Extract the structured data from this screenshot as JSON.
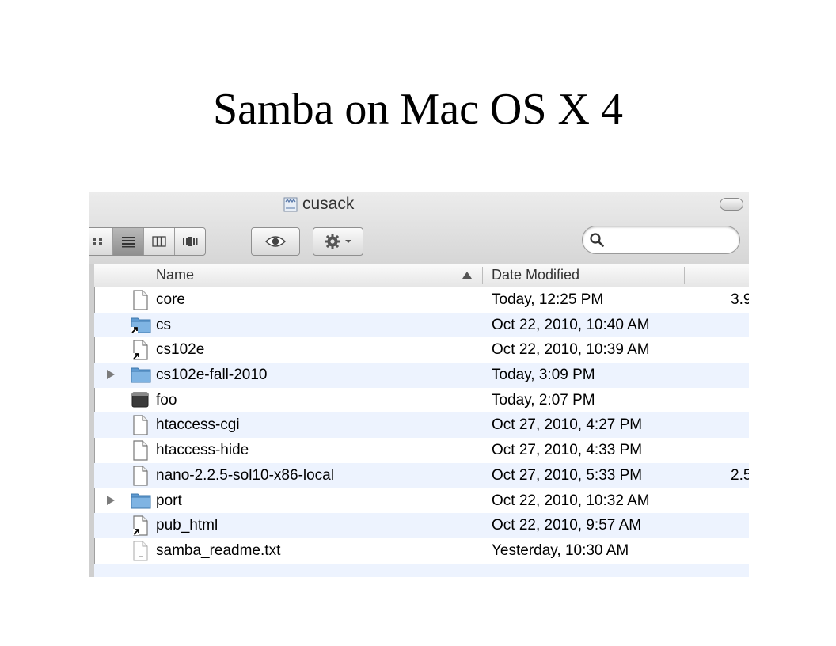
{
  "slide": {
    "title": "Samba on Mac OS X 4"
  },
  "window": {
    "title": "cusack"
  },
  "search": {
    "placeholder": ""
  },
  "columns": {
    "name": "Name",
    "date_modified": "Date Modified"
  },
  "files": [
    {
      "name": "core",
      "date": "Today, 12:25 PM",
      "size": "3.9",
      "icon": "document-icon",
      "expandable": false
    },
    {
      "name": "cs",
      "date": "Oct 22, 2010, 10:40 AM",
      "size": "",
      "icon": "folder-alias-icon",
      "expandable": false
    },
    {
      "name": "cs102e",
      "date": "Oct 22, 2010, 10:39 AM",
      "size": "",
      "icon": "document-alias-icon",
      "expandable": false
    },
    {
      "name": "cs102e-fall-2010",
      "date": "Today, 3:09 PM",
      "size": "",
      "icon": "folder-icon",
      "expandable": true
    },
    {
      "name": "foo",
      "date": "Today, 2:07 PM",
      "size": "",
      "icon": "executable-icon",
      "expandable": false
    },
    {
      "name": "htaccess-cgi",
      "date": "Oct 27, 2010, 4:27 PM",
      "size": "",
      "icon": "document-icon",
      "expandable": false
    },
    {
      "name": "htaccess-hide",
      "date": "Oct 27, 2010, 4:33 PM",
      "size": "",
      "icon": "document-icon",
      "expandable": false
    },
    {
      "name": "nano-2.2.5-sol10-x86-local",
      "date": "Oct 27, 2010, 5:33 PM",
      "size": "2.5",
      "icon": "document-icon",
      "expandable": false
    },
    {
      "name": "port",
      "date": "Oct 22, 2010, 10:32 AM",
      "size": "",
      "icon": "folder-icon",
      "expandable": true
    },
    {
      "name": "pub_html",
      "date": "Oct 22, 2010, 9:57 AM",
      "size": "",
      "icon": "document-alias-icon",
      "expandable": false
    },
    {
      "name": "samba_readme.txt",
      "date": "Yesterday, 10:30 AM",
      "size": "",
      "icon": "text-document-icon",
      "expandable": false
    }
  ],
  "colors": {
    "alt_row": "#edf3fe",
    "folder": "#6aa7dc"
  }
}
